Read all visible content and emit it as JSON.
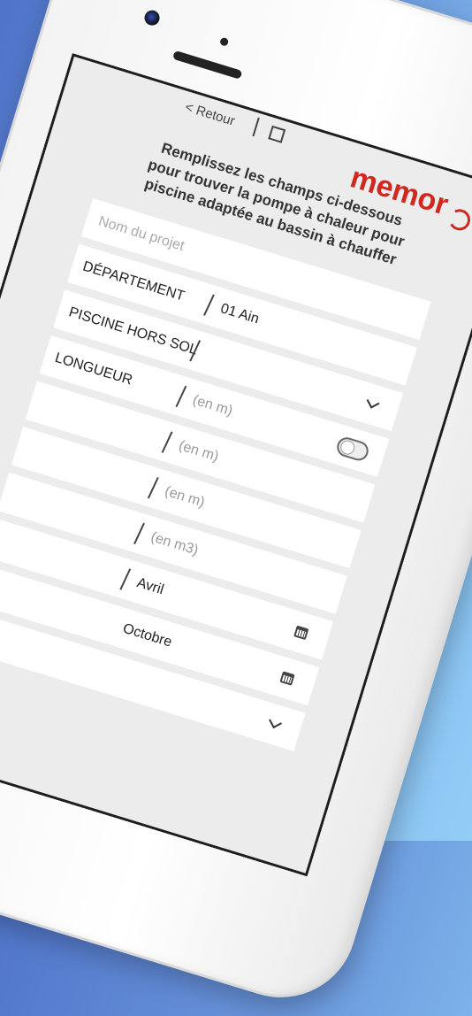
{
  "header": {
    "back_label": "< Retour",
    "brand": "memor"
  },
  "intro_text": "Remplissez les champs ci-dessous pour trouver la pompe à chaleur pour piscine adaptée au bassin à chauffer",
  "form": {
    "project_placeholder": "Nom du projet",
    "departement": {
      "label": "DÉPARTEMENT",
      "value": "01 Ain"
    },
    "hors_sol": {
      "label": "PISCINE HORS SOL"
    },
    "longueur": {
      "label": "LONGUEUR",
      "unit": "(en m)"
    },
    "largeur": {
      "unit": "(en m)"
    },
    "profondeur": {
      "unit": "(en m)"
    },
    "volume": {
      "unit": "(en m3)"
    },
    "debut": {
      "value": "Avril"
    },
    "fin": {
      "value": "Octobre"
    }
  },
  "colors": {
    "brand": "#d0281f",
    "background_start": "#4f73c9",
    "background_end": "#93cdf7"
  }
}
